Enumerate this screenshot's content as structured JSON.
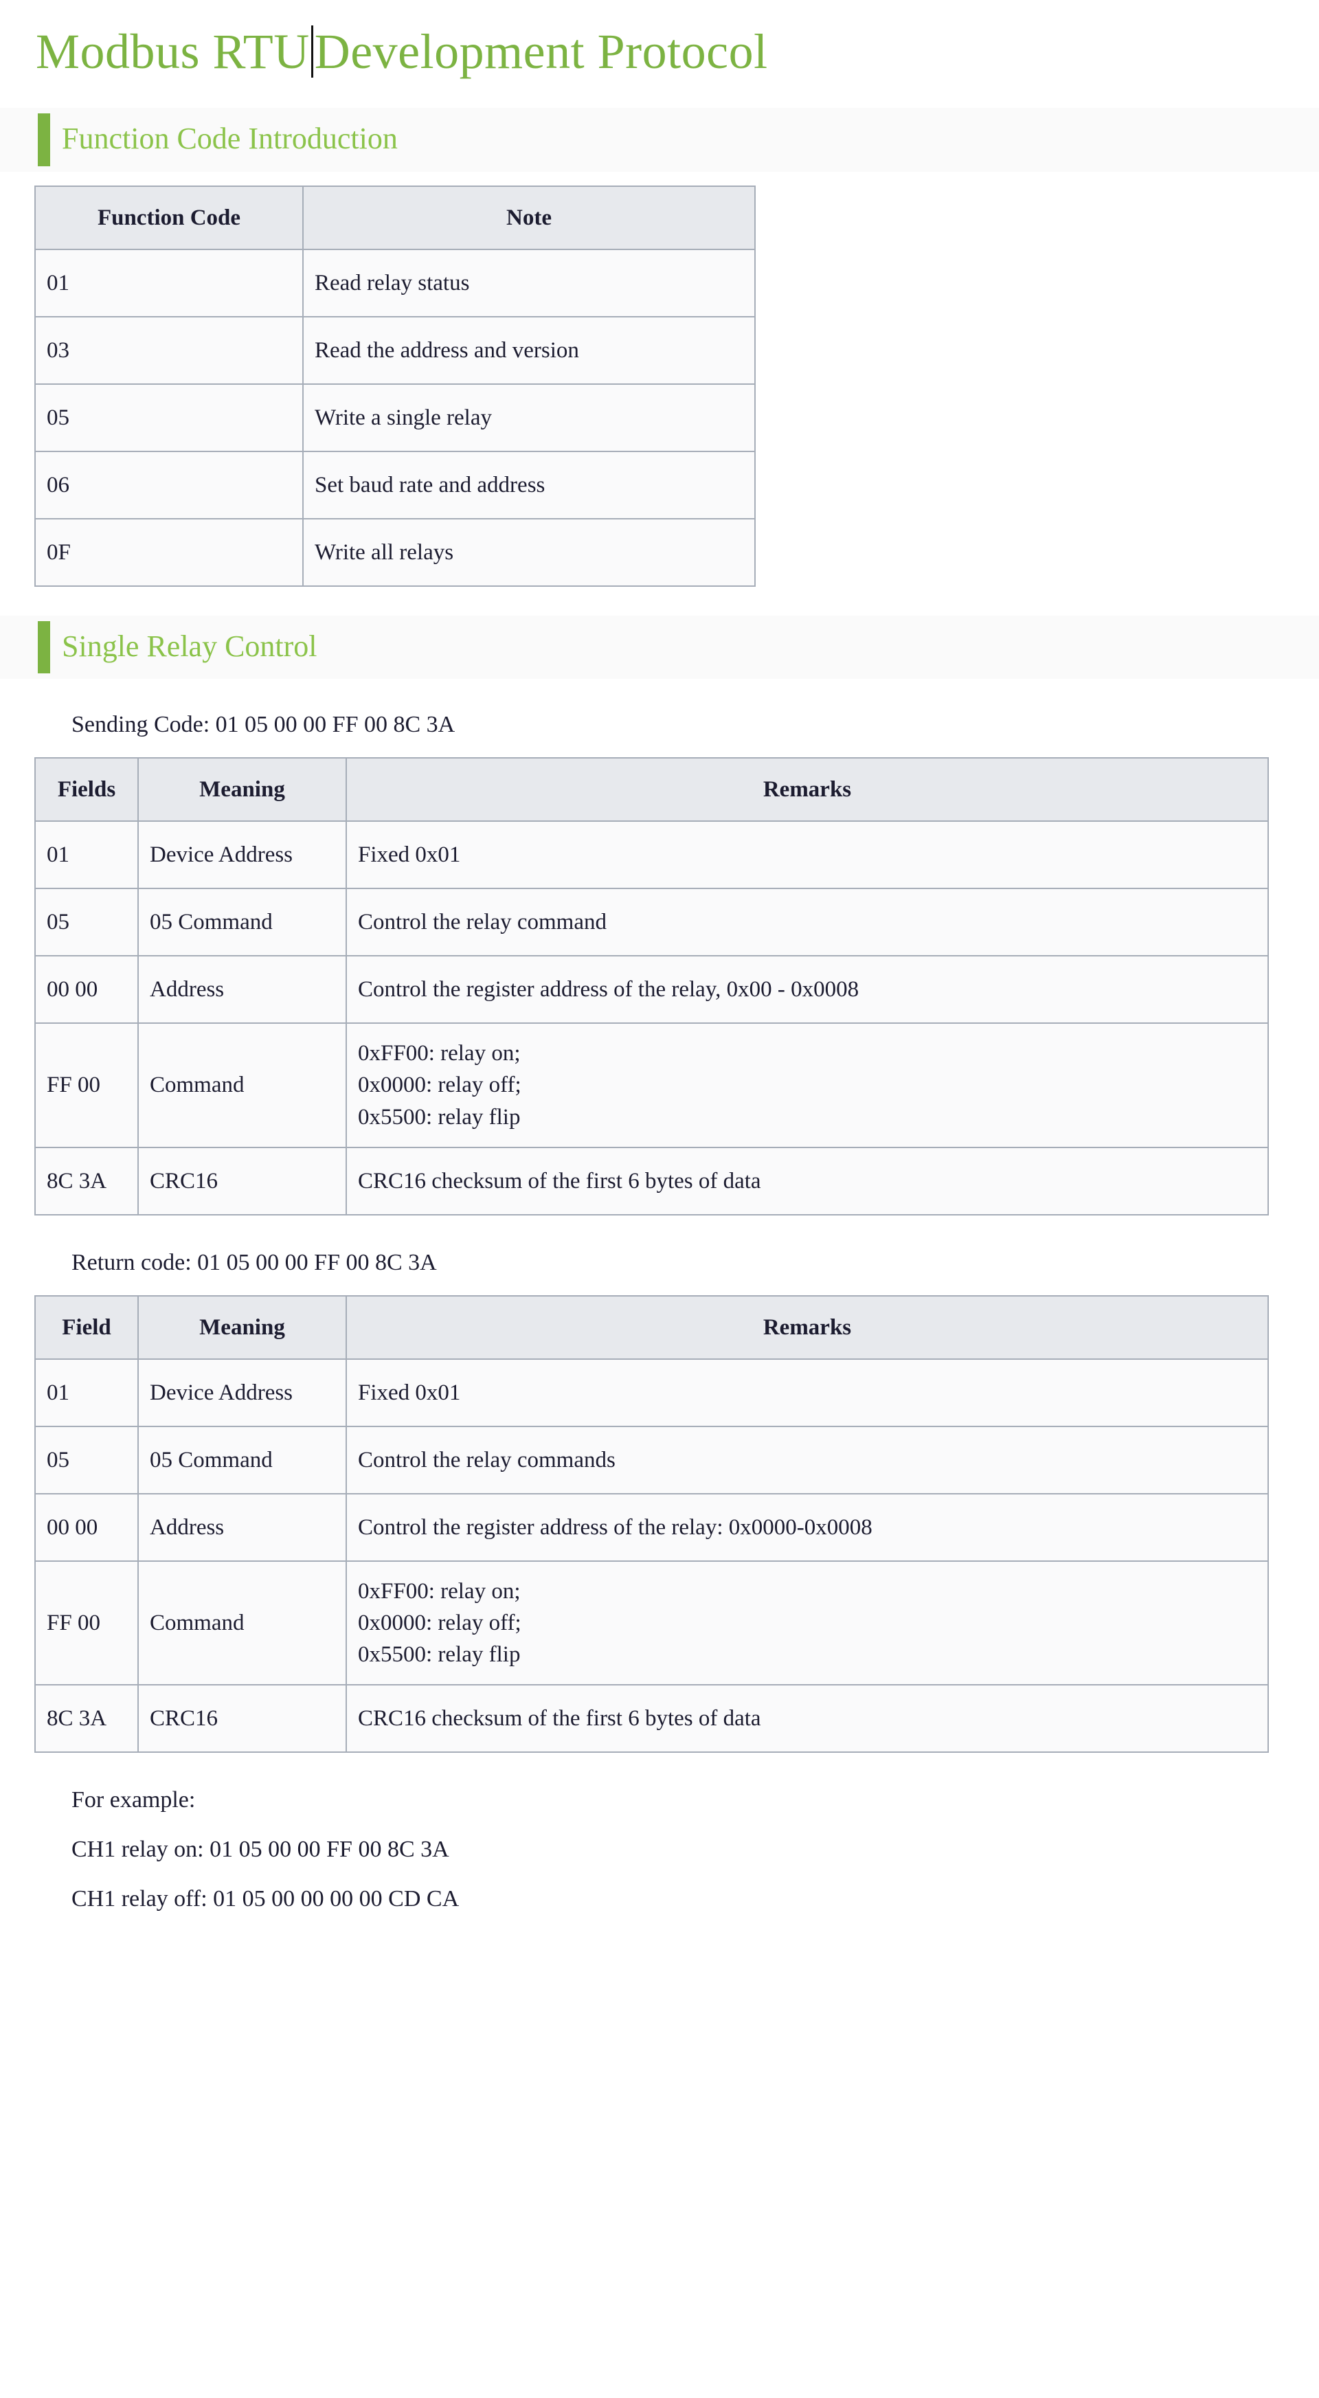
{
  "document": {
    "title_before_caret": "Modbus RTU",
    "title_after_caret": "Development Protocol",
    "accent_green": "#8bc34a",
    "bar_green": "#7cb342",
    "table_border": "#a6adb8",
    "table_header_bg": "#e7e9ed"
  },
  "sections": [
    {
      "heading": "Function Code Introduction"
    },
    {
      "heading": "Single Relay Control"
    }
  ],
  "function_code_table": {
    "headers": [
      "Function Code",
      "Note"
    ],
    "rows": [
      {
        "code": "01",
        "note": "Read relay status"
      },
      {
        "code": "03",
        "note": "Read the address and version"
      },
      {
        "code": "05",
        "note": "Write a single relay"
      },
      {
        "code": "06",
        "note": "Set baud rate and address"
      },
      {
        "code": "0F",
        "note": "Write all relays"
      }
    ]
  },
  "sending": {
    "label": "Sending Code: 01 05 00 00 FF 00 8C 3A",
    "headers": [
      "Fields",
      "Meaning",
      "Remarks"
    ],
    "rows": [
      {
        "field": "01",
        "meaning": "Device Address",
        "remarks": "Fixed 0x01"
      },
      {
        "field": "05",
        "meaning": "05 Command",
        "remarks": "Control the relay command"
      },
      {
        "field": "00 00",
        "meaning": "Address",
        "remarks": "Control the register address of the relay, 0x00 - 0x0008"
      },
      {
        "field": "FF 00",
        "meaning": "Command",
        "remarks_lines": [
          "0xFF00: relay on;",
          "0x0000: relay off;",
          "0x5500: relay flip"
        ]
      },
      {
        "field": "8C 3A",
        "meaning": "CRC16",
        "remarks": "CRC16 checksum of the first 6 bytes of data"
      }
    ]
  },
  "returning": {
    "label": "Return code: 01 05 00 00 FF 00 8C 3A",
    "headers": [
      "Field",
      "Meaning",
      "Remarks"
    ],
    "rows": [
      {
        "field": "01",
        "meaning": "Device Address",
        "remarks": "Fixed 0x01"
      },
      {
        "field": "05",
        "meaning": "05 Command",
        "remarks": "Control the relay commands"
      },
      {
        "field": "00 00",
        "meaning": "Address",
        "remarks": "Control the register address of the relay: 0x0000-0x0008"
      },
      {
        "field": "FF 00",
        "meaning": "Command",
        "remarks_lines": [
          "0xFF00: relay on;",
          "0x0000: relay off;",
          "0x5500: relay flip"
        ]
      },
      {
        "field": "8C 3A",
        "meaning": "CRC16",
        "remarks": "CRC16 checksum of the first 6 bytes of data"
      }
    ]
  },
  "examples": {
    "intro": "For example:",
    "lines": [
      "CH1 relay on: 01 05 00 00 FF 00 8C 3A",
      "CH1 relay off: 01 05 00 00 00 00 CD CA"
    ]
  }
}
